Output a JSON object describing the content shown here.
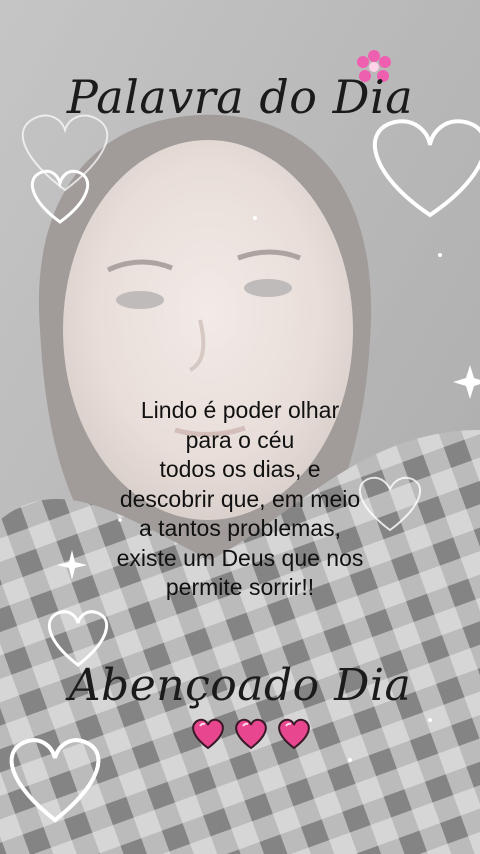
{
  "header": {
    "title": "Palavra do Dia"
  },
  "message": {
    "lines": [
      "Lindo é poder olhar",
      "para o céu",
      "todos os dias, e",
      "descobrir que, em meio",
      "a tantos problemas,",
      "existe um Deus que nos",
      "permite sorrir!!"
    ]
  },
  "footer": {
    "title": "Abençoado Dia"
  },
  "decorations": {
    "heart_color": "#e8478f",
    "flower_color": "#ef5fb0",
    "outline_heart_color": "#ffffff",
    "icons": [
      "flower-icon",
      "heart-outline-icon",
      "sparkle-icon",
      "pink-heart-icon"
    ]
  }
}
